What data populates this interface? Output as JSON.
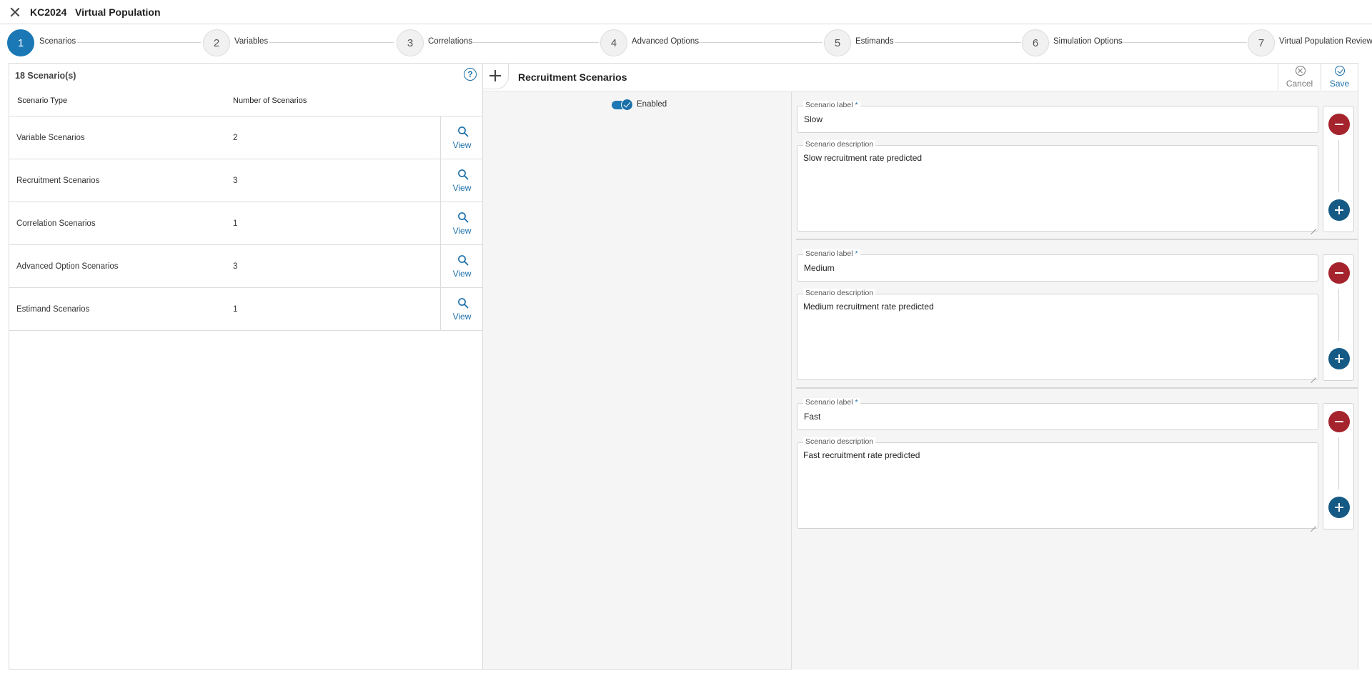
{
  "header": {
    "project": "KC2024",
    "title": "Virtual Population"
  },
  "stepper": {
    "steps": [
      {
        "number": "1",
        "label": "Scenarios",
        "active": true
      },
      {
        "number": "2",
        "label": "Variables"
      },
      {
        "number": "3",
        "label": "Correlations"
      },
      {
        "number": "4",
        "label": "Advanced Options"
      },
      {
        "number": "5",
        "label": "Estimands"
      },
      {
        "number": "6",
        "label": "Simulation Options"
      },
      {
        "number": "7",
        "label": "Virtual Population Review"
      }
    ]
  },
  "left_panel": {
    "count_label": "18 Scenario(s)",
    "help_icon": "?",
    "columns": [
      "Scenario Type",
      "Number of Scenarios"
    ],
    "view_label": "View",
    "rows": [
      {
        "type": "Variable Scenarios",
        "count": "2"
      },
      {
        "type": "Recruitment Scenarios",
        "count": "3"
      },
      {
        "type": "Correlation Scenarios",
        "count": "1"
      },
      {
        "type": "Advanced Option Scenarios",
        "count": "3"
      },
      {
        "type": "Estimand Scenarios",
        "count": "1"
      }
    ]
  },
  "right_panel": {
    "title": "Recruitment Scenarios",
    "cancel_label": "Cancel",
    "save_label": "Save",
    "enabled_label": "Enabled",
    "enabled": true,
    "label_field_legend": "Scenario label",
    "required_marker": "*",
    "desc_field_legend": "Scenario description",
    "scenarios": [
      {
        "label": "Slow",
        "description": "Slow recruitment rate predicted"
      },
      {
        "label": "Medium",
        "description": "Medium recruitment rate predicted"
      },
      {
        "label": "Fast",
        "description": "Fast recruitment rate predicted"
      }
    ]
  },
  "colors": {
    "accent": "#1b78b4",
    "link": "#1b6fa8",
    "remove": "#a5232c",
    "add": "#155a85"
  }
}
